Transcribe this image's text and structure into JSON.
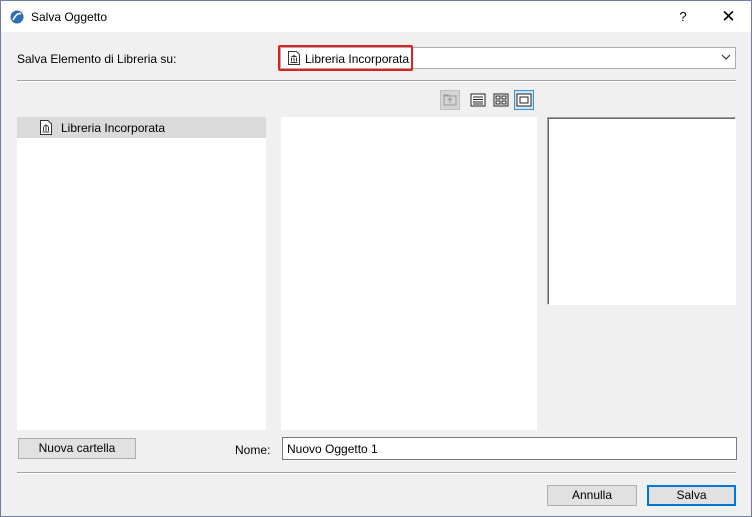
{
  "window": {
    "title": "Salva Oggetto",
    "help_label": "?",
    "close_label": "✕"
  },
  "save_to": {
    "label": "Salva Elemento di Libreria su:",
    "selected": "Libreria Incorporata"
  },
  "view_buttons": [
    {
      "icon": "folder-up-icon",
      "active": false,
      "disabled": true
    },
    {
      "icon": "list-view-icon",
      "active": false,
      "disabled": false
    },
    {
      "icon": "icon-view-icon",
      "active": false,
      "disabled": false
    },
    {
      "icon": "preview-view-icon",
      "active": true,
      "disabled": false
    }
  ],
  "tree": {
    "items": [
      {
        "label": "Libreria Incorporata",
        "icon": "library-icon",
        "selected": true
      }
    ]
  },
  "new_folder_button": "Nuova cartella",
  "name_field": {
    "label": "Nome:",
    "value": "Nuovo Oggetto 1"
  },
  "footer": {
    "cancel_label": "Annulla",
    "save_label": "Salva"
  },
  "colors": {
    "highlight_border": "#e02020",
    "selection_bg": "#dadada",
    "active_view_bg": "#cce4f7",
    "primary_button_border": "#0078d7"
  }
}
